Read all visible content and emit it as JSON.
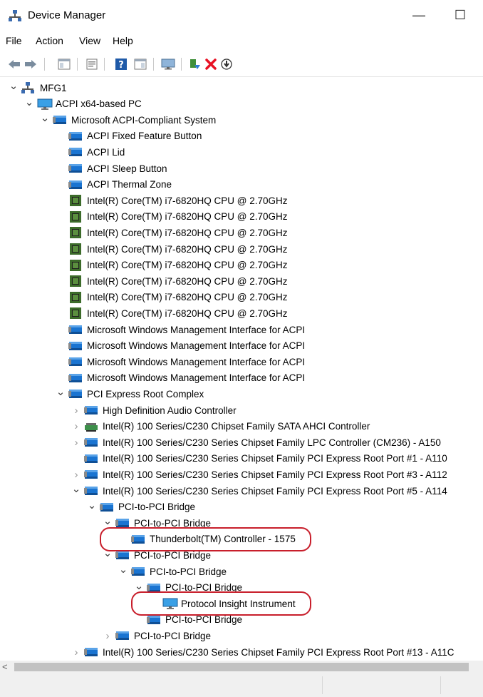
{
  "window": {
    "title": "Device Manager",
    "minimize_glyph": "—",
    "maximize_glyph": "☐"
  },
  "menu": [
    "File",
    "Action",
    "View",
    "Help"
  ],
  "toolbar": {
    "icons": [
      "back-arrow-icon",
      "forward-arrow-icon",
      "show-hide-console-tree-icon",
      "properties-icon",
      "help-icon",
      "action-pane-icon",
      "display-devices-icon",
      "update-driver-icon",
      "uninstall-device-icon",
      "scan-hardware-changes-icon"
    ]
  },
  "colors": {
    "accent_icon": "#1a74d1",
    "cpu_icon": "#3c6b2a",
    "highlight": "#c81e2b",
    "uninstall": "#e81123"
  },
  "tree": [
    {
      "label": "MFG1",
      "level": 0,
      "expander": "expanded",
      "icon": "computer-network-icon",
      "highlight": false
    },
    {
      "label": "ACPI x64-based PC",
      "level": 1,
      "expander": "expanded",
      "icon": "monitor-icon",
      "highlight": false
    },
    {
      "label": "Microsoft ACPI-Compliant System",
      "level": 2,
      "expander": "expanded",
      "icon": "device-icon",
      "highlight": false
    },
    {
      "label": "ACPI Fixed Feature Button",
      "level": 3,
      "expander": "none",
      "icon": "device-icon",
      "highlight": false
    },
    {
      "label": "ACPI Lid",
      "level": 3,
      "expander": "none",
      "icon": "device-icon",
      "highlight": false
    },
    {
      "label": "ACPI Sleep Button",
      "level": 3,
      "expander": "none",
      "icon": "device-icon",
      "highlight": false
    },
    {
      "label": "ACPI Thermal Zone",
      "level": 3,
      "expander": "none",
      "icon": "device-icon",
      "highlight": false
    },
    {
      "label": "Intel(R) Core(TM) i7-6820HQ CPU @ 2.70GHz",
      "level": 3,
      "expander": "none",
      "icon": "cpu-icon",
      "highlight": false
    },
    {
      "label": "Intel(R) Core(TM) i7-6820HQ CPU @ 2.70GHz",
      "level": 3,
      "expander": "none",
      "icon": "cpu-icon",
      "highlight": false
    },
    {
      "label": "Intel(R) Core(TM) i7-6820HQ CPU @ 2.70GHz",
      "level": 3,
      "expander": "none",
      "icon": "cpu-icon",
      "highlight": false
    },
    {
      "label": "Intel(R) Core(TM) i7-6820HQ CPU @ 2.70GHz",
      "level": 3,
      "expander": "none",
      "icon": "cpu-icon",
      "highlight": false
    },
    {
      "label": "Intel(R) Core(TM) i7-6820HQ CPU @ 2.70GHz",
      "level": 3,
      "expander": "none",
      "icon": "cpu-icon",
      "highlight": false
    },
    {
      "label": "Intel(R) Core(TM) i7-6820HQ CPU @ 2.70GHz",
      "level": 3,
      "expander": "none",
      "icon": "cpu-icon",
      "highlight": false
    },
    {
      "label": "Intel(R) Core(TM) i7-6820HQ CPU @ 2.70GHz",
      "level": 3,
      "expander": "none",
      "icon": "cpu-icon",
      "highlight": false
    },
    {
      "label": "Intel(R) Core(TM) i7-6820HQ CPU @ 2.70GHz",
      "level": 3,
      "expander": "none",
      "icon": "cpu-icon",
      "highlight": false
    },
    {
      "label": "Microsoft Windows Management Interface for ACPI",
      "level": 3,
      "expander": "none",
      "icon": "device-icon",
      "highlight": false
    },
    {
      "label": "Microsoft Windows Management Interface for ACPI",
      "level": 3,
      "expander": "none",
      "icon": "device-icon",
      "highlight": false
    },
    {
      "label": "Microsoft Windows Management Interface for ACPI",
      "level": 3,
      "expander": "none",
      "icon": "device-icon",
      "highlight": false
    },
    {
      "label": "Microsoft Windows Management Interface for ACPI",
      "level": 3,
      "expander": "none",
      "icon": "device-icon",
      "highlight": false
    },
    {
      "label": "PCI Express Root Complex",
      "level": 3,
      "expander": "expanded",
      "icon": "device-icon",
      "highlight": false
    },
    {
      "label": "High Definition Audio Controller",
      "level": 4,
      "expander": "collapsed",
      "icon": "device-icon",
      "highlight": false
    },
    {
      "label": "Intel(R) 100 Series/C230 Chipset Family SATA AHCI Controller",
      "level": 4,
      "expander": "collapsed",
      "icon": "storage-controller-icon",
      "highlight": false
    },
    {
      "label": "Intel(R) 100 Series/C230 Series Chipset Family LPC Controller (CM236) - A150",
      "level": 4,
      "expander": "collapsed",
      "icon": "device-icon",
      "highlight": false
    },
    {
      "label": "Intel(R) 100 Series/C230 Series Chipset Family PCI Express Root Port #1 - A110",
      "level": 4,
      "expander": "none",
      "icon": "device-icon",
      "highlight": false
    },
    {
      "label": "Intel(R) 100 Series/C230 Series Chipset Family PCI Express Root Port #3 - A112",
      "level": 4,
      "expander": "collapsed",
      "icon": "device-icon",
      "highlight": false
    },
    {
      "label": "Intel(R) 100 Series/C230 Series Chipset Family PCI Express Root Port #5 - A114",
      "level": 4,
      "expander": "expanded",
      "icon": "device-icon",
      "highlight": false
    },
    {
      "label": "PCI-to-PCI Bridge",
      "level": 5,
      "expander": "expanded",
      "icon": "device-icon",
      "highlight": false
    },
    {
      "label": "PCI-to-PCI Bridge",
      "level": 6,
      "expander": "expanded",
      "icon": "device-icon",
      "highlight": false
    },
    {
      "label": "Thunderbolt(TM) Controller - 1575",
      "level": 7,
      "expander": "none",
      "icon": "device-icon",
      "highlight": true
    },
    {
      "label": "PCI-to-PCI Bridge",
      "level": 6,
      "expander": "expanded",
      "icon": "device-icon",
      "highlight": false
    },
    {
      "label": "PCI-to-PCI Bridge",
      "level": 7,
      "expander": "expanded",
      "icon": "device-icon",
      "highlight": false
    },
    {
      "label": "PCI-to-PCI Bridge",
      "level": 8,
      "expander": "expanded",
      "icon": "device-icon",
      "highlight": false
    },
    {
      "label": "Protocol Insight Instrument",
      "level": 9,
      "expander": "none",
      "icon": "monitor-icon",
      "highlight": true
    },
    {
      "label": "PCI-to-PCI Bridge",
      "level": 8,
      "expander": "none",
      "icon": "device-icon",
      "highlight": false
    },
    {
      "label": "PCI-to-PCI Bridge",
      "level": 6,
      "expander": "collapsed",
      "icon": "device-icon",
      "highlight": false
    },
    {
      "label": "Intel(R) 100 Series/C230 Series Chipset Family PCI Express Root Port #13 - A11C",
      "level": 4,
      "expander": "collapsed",
      "icon": "device-icon",
      "highlight": false
    }
  ]
}
